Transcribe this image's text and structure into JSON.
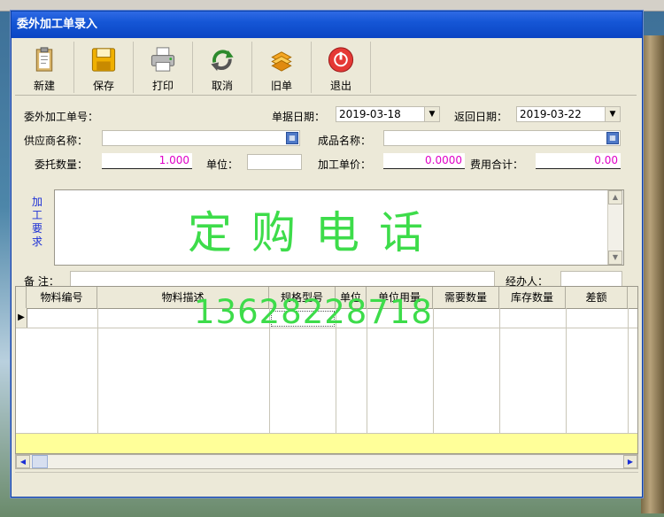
{
  "window": {
    "title": "委外加工单录入"
  },
  "toolbar": [
    {
      "label": "新建",
      "icon": "clipboard-new-icon"
    },
    {
      "label": "保存",
      "icon": "floppy-save-icon"
    },
    {
      "label": "打印",
      "icon": "printer-icon"
    },
    {
      "label": "取消",
      "icon": "refresh-cancel-icon"
    },
    {
      "label": "旧单",
      "icon": "stack-old-icon"
    },
    {
      "label": "退出",
      "icon": "power-exit-icon"
    }
  ],
  "form": {
    "order_no_label": "委外加工单号：",
    "order_date_label": "单据日期：",
    "order_date": "2019-03-18",
    "return_date_label": "返回日期：",
    "return_date": "2019-03-22",
    "supplier_label": "供应商名称：",
    "product_label": "成品名称：",
    "qty_label": "委托数量：",
    "qty": "1.000",
    "unit_label": "单位：",
    "price_label": "加工单价：",
    "price": "0.0000",
    "cost_label": "费用合计：",
    "cost": "0.00",
    "req_label": "加工要求",
    "req_text": "定购电话",
    "remark_label": "备 注：",
    "handler_label": "经办人："
  },
  "grid": {
    "columns": [
      "物料编号",
      "物料描述",
      "规格型号",
      "单位",
      "单位用量",
      "需要数量",
      "库存数量",
      "差额"
    ],
    "overlay": "13628228718"
  }
}
